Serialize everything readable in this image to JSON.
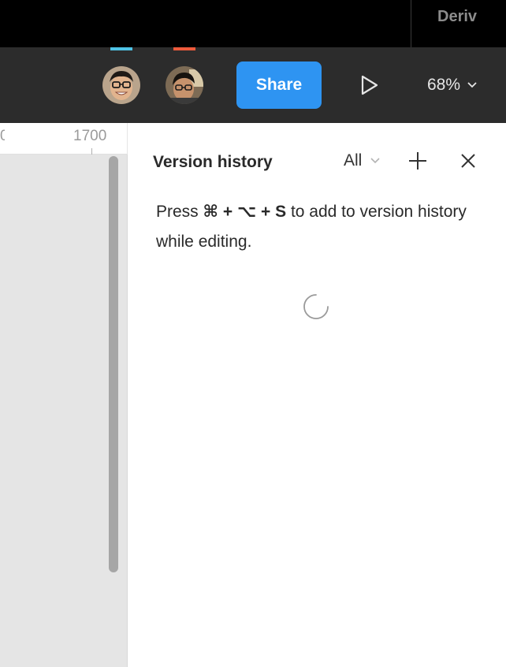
{
  "tabbar": {
    "title": "Deriv"
  },
  "toolbar": {
    "presence_colors": [
      "#4fc3e6",
      "#ee5a3c"
    ],
    "avatars": [
      {
        "name": "collaborator-1"
      },
      {
        "name": "collaborator-2"
      }
    ],
    "share_label": "Share",
    "zoom_label": "68%",
    "accent": "#2e94f2"
  },
  "ruler": {
    "partial_label": "0",
    "label": "1700"
  },
  "version_panel": {
    "title": "Version history",
    "filter_label": "All",
    "hint": {
      "before": "Press",
      "shortcut": "⌘ + ⌥ + S",
      "after": "to add to version history while editing."
    },
    "icons": {
      "filter": "chevron-down-icon",
      "add": "plus-icon",
      "close": "close-icon",
      "loading": "spinner-icon"
    }
  }
}
